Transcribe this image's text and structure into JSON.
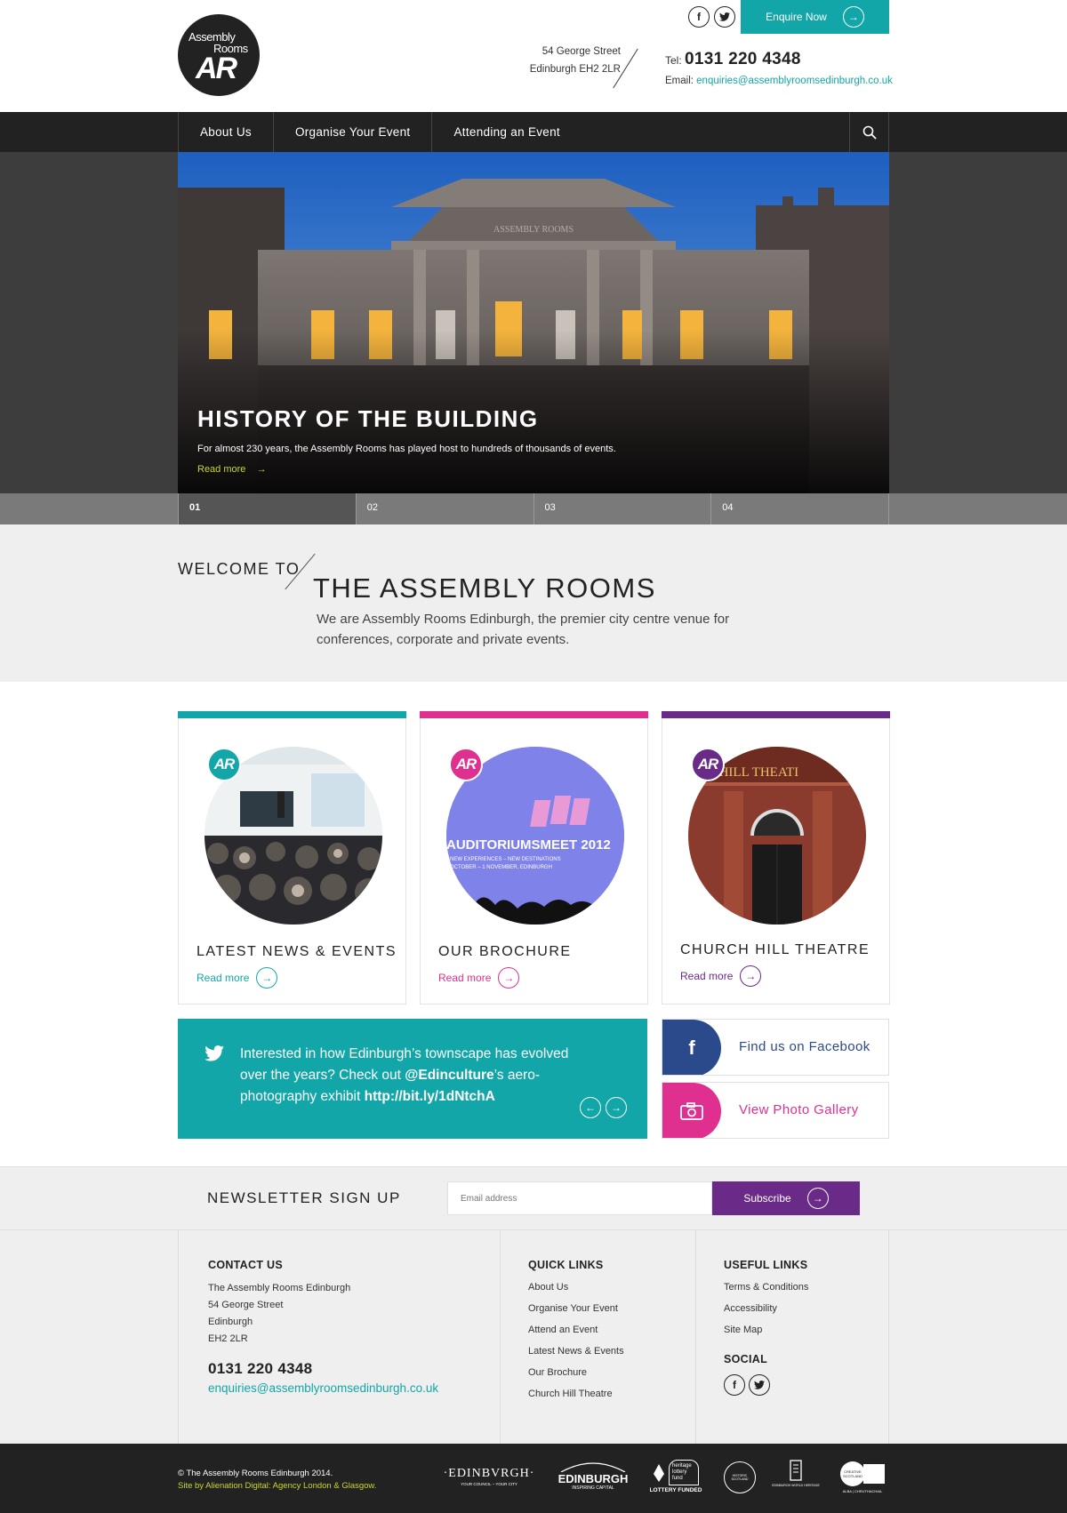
{
  "header": {
    "logo_line1": "Assembly",
    "logo_line2": "Rooms",
    "logo_mark": "AR",
    "social": [
      "facebook-icon",
      "twitter-icon"
    ],
    "enquire_label": "Enquire Now",
    "address_line1": "54 George Street",
    "address_line2": "Edinburgh  EH2 2LR",
    "tel_label": "Tel:",
    "tel_number": "0131 220 4348",
    "email_label": "Email:",
    "email_value": "enquiries@assemblyroomsedinburgh.co.uk"
  },
  "nav": {
    "items": [
      "About Us",
      "Organise Your Event",
      "Attending an Event"
    ],
    "search_icon": "search-icon"
  },
  "hero": {
    "title": "HISTORY OF THE BUILDING",
    "subtitle": "For almost 230 years, the Assembly Rooms has played host to hundreds of thousands of events.",
    "read_more": "Read more",
    "sign": "ASSEMBLY ROOMS",
    "tabs": [
      "01",
      "02",
      "03",
      "04"
    ],
    "active_tab": 0
  },
  "welcome": {
    "small": "WELCOME TO",
    "big": "THE ASSEMBLY ROOMS",
    "description": "We are Assembly Rooms Edinburgh, the premier city centre venue for conferences, corporate and private events."
  },
  "cards": [
    {
      "title": "LATEST NEWS & EVENTS",
      "read_more": "Read more",
      "color": "#13a6a8",
      "badge": "AR"
    },
    {
      "title": "OUR BROCHURE",
      "read_more": "Read more",
      "color": "#e0308f",
      "badge": "AR",
      "screen_line1": "AUDITORIUMSMEET 2012",
      "screen_line2": "NEW EXPERIENCES – NEW DESTINATIONS",
      "screen_line3": "OCTOBER – 1 NOVEMBER, EDINBURGH"
    },
    {
      "title": "CHURCH HILL THEATRE",
      "read_more": "Read more",
      "color": "#6a2a88",
      "badge": "AR",
      "sign": "RCH HILL THEATI"
    }
  ],
  "tweet": {
    "text_a": "Interested in how Edinburgh’s townscape has evolved over the years? Check out ",
    "handle": "@Edinculture",
    "text_b": "’s aero-photography exhibit ",
    "link": "http://bit.ly/1dNtchA"
  },
  "social_cards": [
    {
      "label": "Find us on Facebook",
      "color": "#2b4a8b",
      "icon": "facebook-icon"
    },
    {
      "label": "View Photo Gallery",
      "color": "#e0308f",
      "icon": "camera-icon"
    }
  ],
  "newsletter": {
    "title": "NEWSLETTER SIGN UP",
    "placeholder": "Email address",
    "button": "Subscribe"
  },
  "footer": {
    "contact_title": "CONTACT US",
    "contact_lines": [
      "The Assembly Rooms Edinburgh",
      "54 George Street",
      "Edinburgh",
      "EH2 2LR"
    ],
    "phone": "0131 220 4348",
    "email": "enquiries@assemblyroomsedinburgh.co.uk",
    "quick_title": "QUICK LINKS",
    "quick_links": [
      "About Us",
      "Organise Your Event",
      "Attend an Event",
      "Latest News & Events",
      "Our Brochure",
      "Church Hill Theatre"
    ],
    "useful_title": "USEFUL LINKS",
    "useful_links": [
      "Terms & Conditions",
      "Accessibility",
      "Site Map"
    ],
    "social_title": "SOCIAL"
  },
  "bottom": {
    "copyright": "© The Assembly Rooms Edinburgh 2014.",
    "credit": "Site by Alienation Digital: Agency London & Glasgow.",
    "partners": [
      {
        "name": "·EDINBVRGH·",
        "sub": "YOUR COUNCIL – YOUR CITY"
      },
      {
        "name": "EDINBURGH",
        "sub": "INSPIRING CAPITAL"
      },
      {
        "name": "LOTTERY FUNDED",
        "sub": "heritage lottery fund"
      },
      {
        "name": "HISTORIC SCOTLAND",
        "sub": ""
      },
      {
        "name": "EDINBURGH WORLD HERITAGE",
        "sub": ""
      },
      {
        "name": "CREATIVE SCOTLAND",
        "sub": "ALBA | CHRUTHACHAIL"
      }
    ]
  }
}
